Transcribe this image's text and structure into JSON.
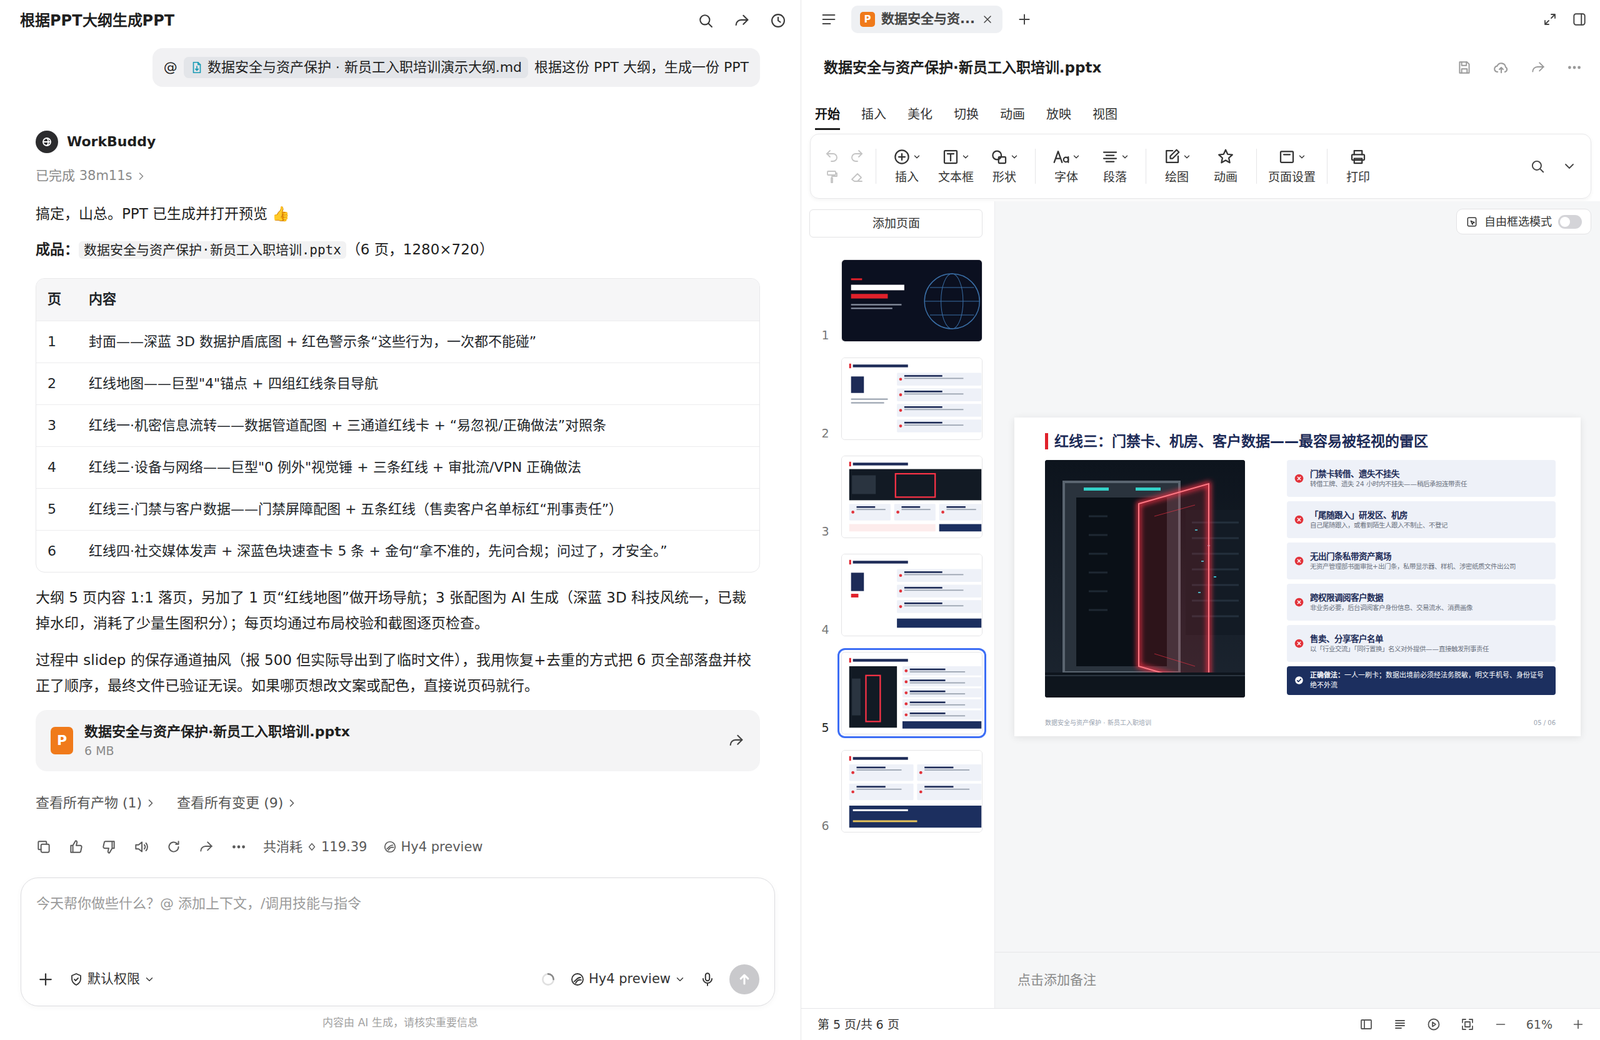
{
  "chat": {
    "header": {
      "title": "根据PPT大纲生成PPT"
    },
    "user_message": {
      "at": "@",
      "attachment": "数据安全与资产保护 · 新员工入职培训演示大纲.md",
      "text": "根据这份 PPT 大纲，生成一份 PPT"
    },
    "assistant": {
      "name": "WorkBuddy",
      "status": "已完成 38m11s",
      "greeting": "搞定，山总。PPT 已生成并打开预览 👍",
      "product": {
        "label": "成品：",
        "file": "数据安全与资产保护·新员工入职培训.pptx",
        "meta": "（6 页，1280×720）"
      },
      "table": {
        "columns": [
          "页",
          "内容"
        ],
        "rows": [
          [
            "1",
            "封面——深蓝 3D 数据护盾底图 + 红色警示条“这些行为，一次都不能碰”"
          ],
          [
            "2",
            "红线地图——巨型\"4\"锚点 + 四组红线条目导航"
          ],
          [
            "3",
            "红线一·机密信息流转——数据管道配图 + 三通道红线卡 + “易忽视/正确做法”对照条"
          ],
          [
            "4",
            "红线二·设备与网络——巨型\"0 例外\"视觉锤 + 三条红线 + 审批流/VPN 正确做法"
          ],
          [
            "5",
            "红线三·门禁与客户数据——门禁屏障配图 + 五条红线（售卖客户名单标红“刑事责任”）"
          ],
          [
            "6",
            "红线四·社交媒体发声 + 深蓝色块速查卡 5 条 + 金句“拿不准的，先问合规；问过了，才安全。”"
          ]
        ]
      },
      "paragraphs": [
        "大纲 5 页内容 1:1 落页，另加了 1 页“红线地图”做开场导航；3 张配图为 AI 生成（深蓝 3D 科技风统一，已裁掉水印，消耗了少量生图积分）；每页均通过布局校验和截图逐页检查。",
        "过程中 slidep 的保存通道抽风（报 500 但实际导出到了临时文件），我用恢复+去重的方式把 6 页全部落盘并校正了顺序，最终文件已验证无误。如果哪页想改文案或配色，直接说页码就行。"
      ],
      "file_card": {
        "badge": "P",
        "name": "数据安全与资产保护·新员工入职培训.pptx",
        "size": "6 MB"
      },
      "links": [
        "查看所有产物 (1)",
        "查看所有变更 (9)"
      ],
      "usage": {
        "label": "共消耗",
        "amount": "119.39"
      },
      "model": "Hy4 preview"
    },
    "composer": {
      "placeholder": "今天帮你做些什么？@ 添加上下文，/调用技能与指令",
      "permission": "默认权限",
      "model": "Hy4 preview",
      "busy": true
    },
    "disclaimer": "内容由 AI 生成，请核实重要信息"
  },
  "editor": {
    "tab": {
      "badge": "P",
      "label": "数据安全与资...",
      "selected": true
    },
    "file_title": "数据安全与资产保护·新员工入职培训.pptx",
    "ribbon_tabs": [
      {
        "label": "开始",
        "selected": true
      },
      {
        "label": "插入",
        "selected": false
      },
      {
        "label": "美化",
        "selected": false
      },
      {
        "label": "切换",
        "selected": false
      },
      {
        "label": "动画",
        "selected": false
      },
      {
        "label": "放映",
        "selected": false
      },
      {
        "label": "视图",
        "selected": false
      }
    ],
    "history_tools": {
      "undo_disabled": true,
      "redo_disabled": true,
      "painter_disabled": true,
      "eraser_disabled": true
    },
    "toolbar_groups": [
      [
        {
          "label": "插入",
          "dropdown": true
        },
        {
          "label": "文本框",
          "dropdown": true
        },
        {
          "label": "形状",
          "dropdown": true
        }
      ],
      [
        {
          "label": "字体",
          "dropdown": true
        },
        {
          "label": "段落",
          "dropdown": true
        }
      ],
      [
        {
          "label": "绘图",
          "dropdown": true
        },
        {
          "label": "动画",
          "dropdown": false
        }
      ],
      [
        {
          "label": "页面设置",
          "dropdown": true
        }
      ],
      [
        {
          "label": "打印",
          "dropdown": false
        }
      ]
    ],
    "add_page": "添加页面",
    "slides": [
      {
        "number": "1",
        "kind": "cover",
        "selected": false
      },
      {
        "number": "2",
        "kind": "map",
        "selected": false
      },
      {
        "number": "3",
        "kind": "photo",
        "selected": false
      },
      {
        "number": "4",
        "kind": "bignum",
        "selected": false
      },
      {
        "number": "5",
        "kind": "photoside",
        "selected": true
      },
      {
        "number": "6",
        "kind": "cards",
        "selected": false
      }
    ],
    "free_select": {
      "label": "自由框选模式",
      "on": false
    },
    "slide": {
      "title": "红线三：门禁卡、机房、客户数据——最容易被轻视的雷区",
      "items": [
        {
          "kind": "warn",
          "title": "门禁卡转借、遗失不挂失",
          "desc": "转借工牌、遗失 24 小时内不挂失——稍后承担连带责任"
        },
        {
          "kind": "warn",
          "title": "「尾随跟入」研发区、机房",
          "desc": "自己尾随跟入，或看到陌生人跟入不制止、不登记"
        },
        {
          "kind": "warn",
          "title": "无出门条私带资产离场",
          "desc": "无资产管理部书面审批+出门条，私带显示器、样机、涉密纸质文件出公司"
        },
        {
          "kind": "warn",
          "title": "跨权限调阅客户数据",
          "desc": "非业务必要，后台调阅客户身份信息、交易流水、消费画像"
        },
        {
          "kind": "warn",
          "title": "售卖、分享客户名单",
          "desc": "以「行业交流」「同行置换」名义对外提供——直接触发刑事责任"
        },
        {
          "kind": "correct",
          "title": "正确做法：",
          "desc": "一人一刷卡；数据出境前必须经法务脱敏，明文手机号、身份证号绝不外流"
        }
      ],
      "footer_left": "数据安全与资产保护 · 新员工入职培训",
      "footer_right": "05 / 06"
    },
    "notes_placeholder": "点击添加备注",
    "status": {
      "page": "第 5 页/共 6 页",
      "zoom": "61%"
    }
  }
}
